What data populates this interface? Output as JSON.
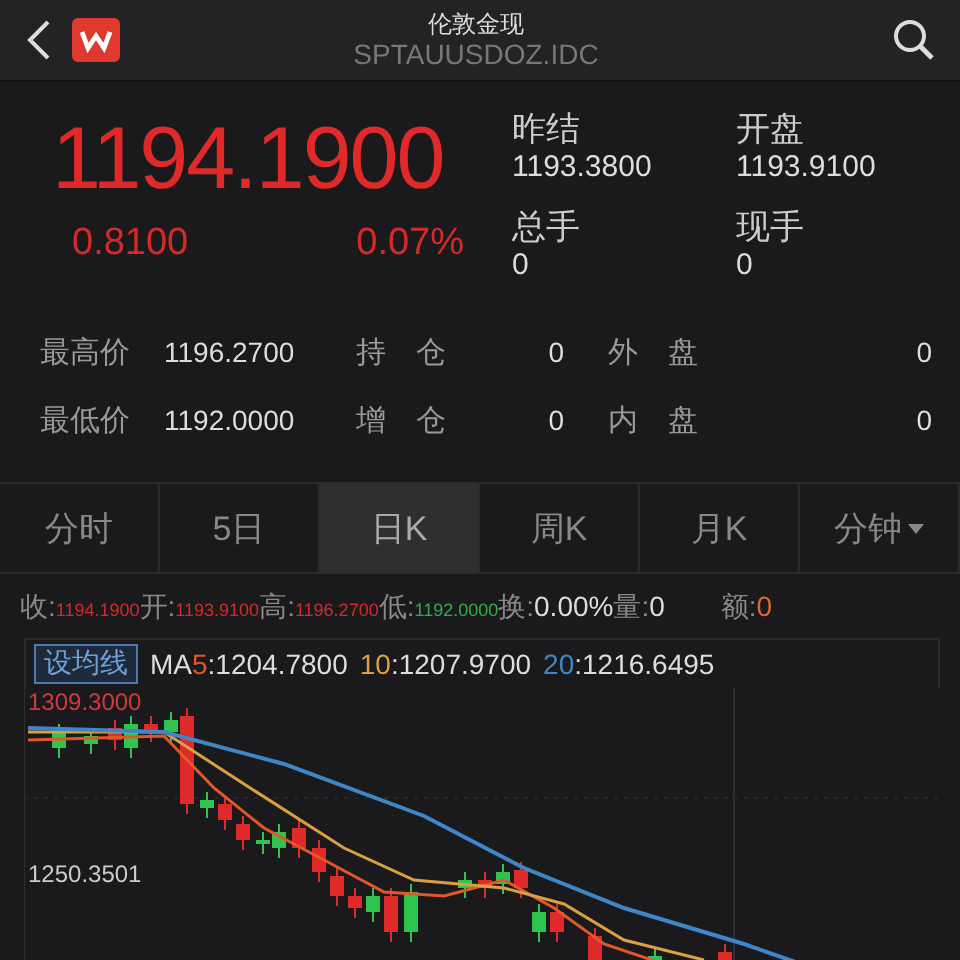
{
  "header": {
    "title": "伦敦金现",
    "code": "SPTAUUSDOZ.IDC"
  },
  "quote": {
    "price": "1194.1900",
    "change": "0.8100",
    "change_pct": "0.07%"
  },
  "summary": [
    {
      "label": "昨结",
      "value": "1193.3800"
    },
    {
      "label": "开盘",
      "value": "1193.9100"
    },
    {
      "label": "总手",
      "value": "0"
    },
    {
      "label": "现手",
      "value": "0"
    }
  ],
  "stats": [
    [
      {
        "label": "最高价",
        "value": "1196.2700"
      },
      {
        "label": "持　仓",
        "value": "0"
      },
      {
        "label": "外　盘",
        "value": "0"
      }
    ],
    [
      {
        "label": "最低价",
        "value": "1192.0000"
      },
      {
        "label": "增　仓",
        "value": "0"
      },
      {
        "label": "内　盘",
        "value": "0"
      }
    ]
  ],
  "tabs": [
    {
      "label": "分时",
      "selected": false,
      "dropdown": false
    },
    {
      "label": "5日",
      "selected": false,
      "dropdown": false
    },
    {
      "label": "日K",
      "selected": true,
      "dropdown": false
    },
    {
      "label": "周K",
      "selected": false,
      "dropdown": false
    },
    {
      "label": "月K",
      "selected": false,
      "dropdown": false
    },
    {
      "label": "分钟",
      "selected": false,
      "dropdown": true
    }
  ],
  "info_bar": [
    {
      "label": "收:",
      "value": "1194.1900",
      "color": "#d42a2a"
    },
    {
      "label": "开:",
      "value": "1193.9100",
      "color": "#d42a2a"
    },
    {
      "label": "高:",
      "value": "1196.2700",
      "color": "#d42a2a"
    },
    {
      "label": "低:",
      "value": "1192.0000",
      "color": "#2fae48"
    },
    {
      "label": "换:",
      "value": "0.00%",
      "color": "#dddddd"
    },
    {
      "label": "量:",
      "value": "0",
      "color": "#dddddd"
    },
    {
      "label": "额:",
      "value": "0",
      "color": "#e0662e"
    }
  ],
  "ma": {
    "button": "设均线",
    "lines": [
      {
        "prefix": "MA",
        "period": "5",
        "value": ":1204.7800",
        "color": "#e0582a"
      },
      {
        "period": "10",
        "value": ":1207.9700",
        "color": "#d9a040"
      },
      {
        "period": "20",
        "value": ":1216.6495",
        "color": "#3f86c6"
      }
    ]
  },
  "chart": {
    "y_labels": [
      "1309.3000",
      "1250.3501"
    ]
  }
}
